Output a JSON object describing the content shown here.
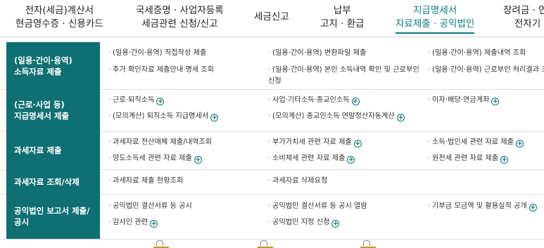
{
  "nav": {
    "items": [
      {
        "line1": "전자(세금)계산서",
        "line2": "현금영수증 · 신용카드"
      },
      {
        "line1": "국세증명 · 사업자등록",
        "line2": "세금관련 신청/신고"
      },
      {
        "line1": "세금신고",
        "line2": ""
      },
      {
        "line1": "납부",
        "line2": "고지 · 환급"
      },
      {
        "line1": "지급명세서",
        "line2": "자료제출 · 공익법인"
      },
      {
        "line1": "장려금 · 연",
        "line2": "전자기"
      }
    ],
    "active_color": "#0a7d83"
  },
  "menu": {
    "rows": [
      {
        "category": [
          "(일용·간이·용역)",
          "소득자료 제출"
        ],
        "cols": [
          [
            {
              "text": "(일용·간이·용역) 직접작성 제출"
            },
            {
              "text": "추가 확인자료 제출안내 명세 조회"
            }
          ],
          [
            {
              "text": "(일용·간이·용역) 변환파일 제출"
            },
            {
              "text": "(일용·간이·용역) 본인 소득내역 확인 및 근로부인 신청"
            }
          ],
          [
            {
              "text": "(일용·간이·용역) 제출내역 조회"
            },
            {
              "text": "(일용·간이·용역) 근로부인 처리결과 조회"
            }
          ]
        ]
      },
      {
        "category": [
          "(근로·사업 등)",
          "지급명세서 제출"
        ],
        "cols": [
          [
            {
              "text": "근로·퇴직소득",
              "plus": true
            },
            {
              "text": "(모의계산) 퇴직소득 지급명세서",
              "plus": true
            }
          ],
          [
            {
              "text": "사업·기타소득·종교인소득",
              "plus": true
            },
            {
              "text": "(모의계산) 종교인소득 연말정산자동계산",
              "plus": true
            }
          ],
          [
            {
              "text": "이자·배당·연금계좌",
              "plus": true
            }
          ]
        ]
      },
      {
        "category": [
          "과세자료 제출"
        ],
        "cols": [
          [
            {
              "text": "과세자료 전산매체 제출/내역조회"
            },
            {
              "text": "양도소득세 관련 자료 제출",
              "plus": true
            }
          ],
          [
            {
              "text": "부가가치세 관련 자료 제출",
              "plus": true
            },
            {
              "text": "소비제세 관련 자료 제출",
              "plus": true
            }
          ],
          [
            {
              "text": "소득·법인세 관련 자료 제출",
              "plus": true
            },
            {
              "text": "원천세 관련 자료 제출",
              "plus": true
            }
          ]
        ]
      },
      {
        "category": [
          "과세자료 조회/삭제"
        ],
        "cols": [
          [
            {
              "text": "과세자료 제출 현황조회"
            }
          ],
          [
            {
              "text": "과세자료 삭제요청"
            }
          ],
          []
        ]
      },
      {
        "category": [
          "공익법인 보고서 제출/",
          "공시"
        ],
        "cols": [
          [
            {
              "text": "공익법인 결산서류 등 공시"
            },
            {
              "text": "감사인 관련",
              "plus": true
            }
          ],
          [
            {
              "text": "공익법인 결산서류 등 공시 열람"
            },
            {
              "text": "공익법인 지정 신청",
              "plus": true
            }
          ],
          [
            {
              "text": "기부금 모금액 및 활용실적 공개",
              "plus": true
            }
          ]
        ]
      }
    ],
    "category_color": "#0f6f73",
    "plus_symbol": "+"
  }
}
